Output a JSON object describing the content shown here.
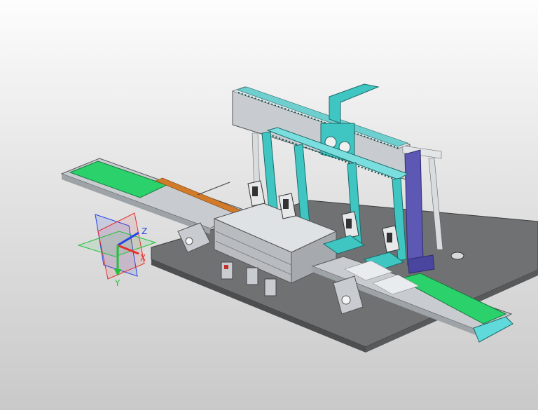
{
  "triad": {
    "x_label": "X",
    "y_label": "Y",
    "z_label": "Z"
  },
  "colors": {
    "background_top": "#fdfdfd",
    "background_bottom": "#c9c9c9",
    "base_plate": "#6f7173",
    "frame_metal": "#c8ccd0",
    "gantry_cyan": "#3fc6c2",
    "conveyor_belt": "#2bd16a",
    "motor_purple": "#5c58b4",
    "accent_orange": "#d07a2a",
    "axis_x": "#e43030",
    "axis_y": "#22c13a",
    "axis_z": "#2442e6"
  },
  "model": {
    "name_icon": "cad-assembly-icon",
    "parts": [
      "base-plate",
      "left-conveyor",
      "right-conveyor",
      "gantry-frame",
      "linear-rail",
      "cyan-columns",
      "motor-block",
      "fixture-block",
      "grippers",
      "mounting-bracket"
    ]
  }
}
